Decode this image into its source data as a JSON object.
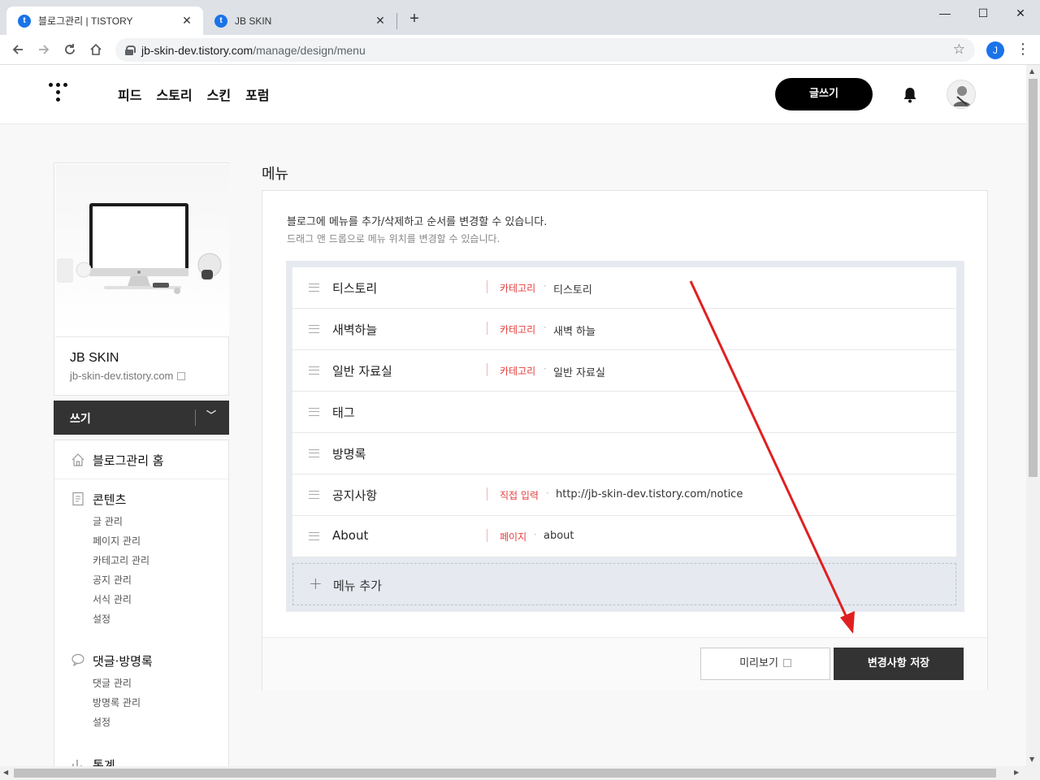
{
  "browser": {
    "tabs": [
      {
        "title": "블로그관리 | TISTORY",
        "active": true
      },
      {
        "title": "JB SKIN",
        "active": false
      }
    ],
    "close_glyph": "✕",
    "new_tab_glyph": "+",
    "url_host": "jb-skin-dev.tistory.com",
    "url_path": "/manage/design/menu",
    "profile_initial": "J",
    "window_controls": {
      "minimize": "—",
      "maximize": "☐",
      "close": "✕"
    }
  },
  "header": {
    "nav": [
      "피드",
      "스토리",
      "스킨",
      "포럼"
    ],
    "write_label": "글쓰기"
  },
  "sidebar": {
    "blog_name": "JB SKIN",
    "blog_url": "jb-skin-dev.tistory.com",
    "write_label": "쓰기",
    "home_label": "블로그관리 홈",
    "groups": [
      {
        "title": "콘텐츠",
        "items": [
          "글 관리",
          "페이지 관리",
          "카테고리 관리",
          "공지 관리",
          "서식 관리",
          "설정"
        ]
      },
      {
        "title": "댓글·방명록",
        "items": [
          "댓글 관리",
          "방명록 관리",
          "설정"
        ]
      },
      {
        "title": "통계",
        "items": []
      }
    ]
  },
  "main": {
    "title": "메뉴",
    "desc1": "블로그에 메뉴를 추가/삭제하고 순서를 변경할 수 있습니다.",
    "desc2": "드래그 앤 드롭으로 메뉴 위치를 변경할 수 있습니다.",
    "menu_items": [
      {
        "name": "티스토리",
        "type": "카테고리",
        "value": "티스토리"
      },
      {
        "name": "새벽하늘",
        "type": "카테고리",
        "value": "새벽 하늘"
      },
      {
        "name": "일반 자료실",
        "type": "카테고리",
        "value": "일반 자료실"
      },
      {
        "name": "태그",
        "type": "",
        "value": ""
      },
      {
        "name": "방명록",
        "type": "",
        "value": ""
      },
      {
        "name": "공지사항",
        "type": "직접 입력",
        "value": "http://jb-skin-dev.tistory.com/notice"
      },
      {
        "name": "About",
        "type": "페이지",
        "value": "about"
      }
    ],
    "add_label": "메뉴 추가",
    "preview_label": "미리보기",
    "save_label": "변경사항 저장"
  },
  "colors": {
    "accent_red": "#e53e3e",
    "annotation_arrow": "#e02020",
    "dark_button": "#333333"
  }
}
